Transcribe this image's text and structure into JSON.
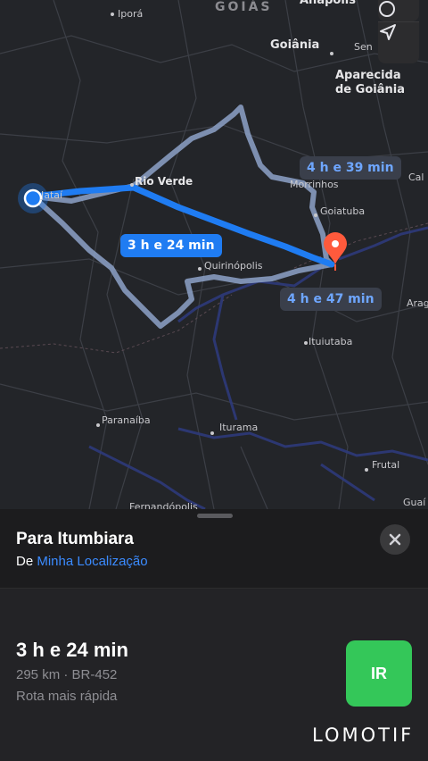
{
  "map": {
    "region_label": "GOIÁS",
    "cities": [
      {
        "name": "Iporá",
        "key": "ipora"
      },
      {
        "name": "Anápolis",
        "key": "anapolis"
      },
      {
        "name": "Goiânia",
        "key": "goiania"
      },
      {
        "name": "Sen",
        "key": "sen"
      },
      {
        "name": "Aparecida de Goiânia",
        "key": "aparecida"
      },
      {
        "name": "Rio Verde",
        "key": "rio-verde"
      },
      {
        "name": "Jataí",
        "key": "jatai"
      },
      {
        "name": "Morrinhos",
        "key": "morrinhos"
      },
      {
        "name": "Cal",
        "key": "cal"
      },
      {
        "name": "Goiatuba",
        "key": "goiatuba"
      },
      {
        "name": "Quirinópolis",
        "key": "quirinopolis"
      },
      {
        "name": "Arag",
        "key": "arag"
      },
      {
        "name": "Ituiutaba",
        "key": "ituiutaba"
      },
      {
        "name": "Paranaíba",
        "key": "paranaiba"
      },
      {
        "name": "Iturama",
        "key": "iturama"
      },
      {
        "name": "Frutal",
        "key": "frutal"
      },
      {
        "name": "Fernandópolis",
        "key": "fernandopolis"
      },
      {
        "name": "Guaí",
        "key": "guai"
      }
    ],
    "route_labels": {
      "primary": "3 h e 24 min",
      "alt_north": "4 h e 39 min",
      "alt_south": "4 h e 47 min"
    },
    "icons": [
      "info-icon",
      "location-arrow-icon",
      "destination-pin-icon",
      "current-location-icon"
    ],
    "colors": {
      "primary_route": "#1f7cf2",
      "alt_route": "#8da2c8"
    }
  },
  "sheet": {
    "title": "Para Itumbiara",
    "from_prefix": "De",
    "from_link": "Minha Localização",
    "route": {
      "time": "3 h e 24 min",
      "meta": "295 km · BR-452",
      "description": "Rota mais rápida",
      "go_label": "IR"
    },
    "watermark": "LOMOTIF"
  }
}
